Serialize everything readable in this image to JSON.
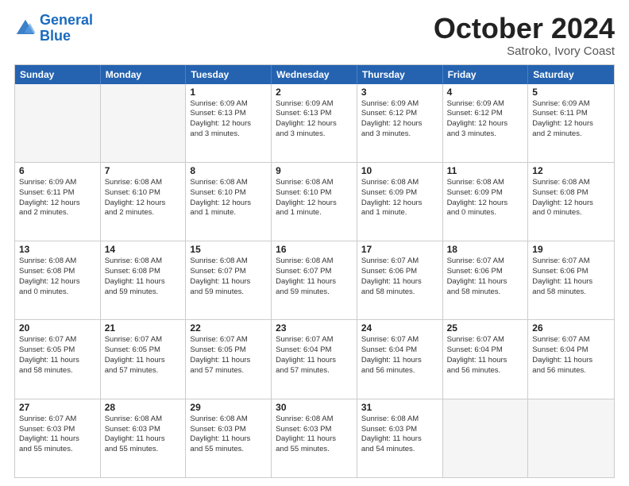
{
  "logo": {
    "line1": "General",
    "line2": "Blue"
  },
  "title": "October 2024",
  "subtitle": "Satroko, Ivory Coast",
  "headers": [
    "Sunday",
    "Monday",
    "Tuesday",
    "Wednesday",
    "Thursday",
    "Friday",
    "Saturday"
  ],
  "weeks": [
    [
      {
        "day": "",
        "lines": []
      },
      {
        "day": "",
        "lines": []
      },
      {
        "day": "1",
        "lines": [
          "Sunrise: 6:09 AM",
          "Sunset: 6:13 PM",
          "Daylight: 12 hours",
          "and 3 minutes."
        ]
      },
      {
        "day": "2",
        "lines": [
          "Sunrise: 6:09 AM",
          "Sunset: 6:13 PM",
          "Daylight: 12 hours",
          "and 3 minutes."
        ]
      },
      {
        "day": "3",
        "lines": [
          "Sunrise: 6:09 AM",
          "Sunset: 6:12 PM",
          "Daylight: 12 hours",
          "and 3 minutes."
        ]
      },
      {
        "day": "4",
        "lines": [
          "Sunrise: 6:09 AM",
          "Sunset: 6:12 PM",
          "Daylight: 12 hours",
          "and 3 minutes."
        ]
      },
      {
        "day": "5",
        "lines": [
          "Sunrise: 6:09 AM",
          "Sunset: 6:11 PM",
          "Daylight: 12 hours",
          "and 2 minutes."
        ]
      }
    ],
    [
      {
        "day": "6",
        "lines": [
          "Sunrise: 6:09 AM",
          "Sunset: 6:11 PM",
          "Daylight: 12 hours",
          "and 2 minutes."
        ]
      },
      {
        "day": "7",
        "lines": [
          "Sunrise: 6:08 AM",
          "Sunset: 6:10 PM",
          "Daylight: 12 hours",
          "and 2 minutes."
        ]
      },
      {
        "day": "8",
        "lines": [
          "Sunrise: 6:08 AM",
          "Sunset: 6:10 PM",
          "Daylight: 12 hours",
          "and 1 minute."
        ]
      },
      {
        "day": "9",
        "lines": [
          "Sunrise: 6:08 AM",
          "Sunset: 6:10 PM",
          "Daylight: 12 hours",
          "and 1 minute."
        ]
      },
      {
        "day": "10",
        "lines": [
          "Sunrise: 6:08 AM",
          "Sunset: 6:09 PM",
          "Daylight: 12 hours",
          "and 1 minute."
        ]
      },
      {
        "day": "11",
        "lines": [
          "Sunrise: 6:08 AM",
          "Sunset: 6:09 PM",
          "Daylight: 12 hours",
          "and 0 minutes."
        ]
      },
      {
        "day": "12",
        "lines": [
          "Sunrise: 6:08 AM",
          "Sunset: 6:08 PM",
          "Daylight: 12 hours",
          "and 0 minutes."
        ]
      }
    ],
    [
      {
        "day": "13",
        "lines": [
          "Sunrise: 6:08 AM",
          "Sunset: 6:08 PM",
          "Daylight: 12 hours",
          "and 0 minutes."
        ]
      },
      {
        "day": "14",
        "lines": [
          "Sunrise: 6:08 AM",
          "Sunset: 6:08 PM",
          "Daylight: 11 hours",
          "and 59 minutes."
        ]
      },
      {
        "day": "15",
        "lines": [
          "Sunrise: 6:08 AM",
          "Sunset: 6:07 PM",
          "Daylight: 11 hours",
          "and 59 minutes."
        ]
      },
      {
        "day": "16",
        "lines": [
          "Sunrise: 6:08 AM",
          "Sunset: 6:07 PM",
          "Daylight: 11 hours",
          "and 59 minutes."
        ]
      },
      {
        "day": "17",
        "lines": [
          "Sunrise: 6:07 AM",
          "Sunset: 6:06 PM",
          "Daylight: 11 hours",
          "and 58 minutes."
        ]
      },
      {
        "day": "18",
        "lines": [
          "Sunrise: 6:07 AM",
          "Sunset: 6:06 PM",
          "Daylight: 11 hours",
          "and 58 minutes."
        ]
      },
      {
        "day": "19",
        "lines": [
          "Sunrise: 6:07 AM",
          "Sunset: 6:06 PM",
          "Daylight: 11 hours",
          "and 58 minutes."
        ]
      }
    ],
    [
      {
        "day": "20",
        "lines": [
          "Sunrise: 6:07 AM",
          "Sunset: 6:05 PM",
          "Daylight: 11 hours",
          "and 58 minutes."
        ]
      },
      {
        "day": "21",
        "lines": [
          "Sunrise: 6:07 AM",
          "Sunset: 6:05 PM",
          "Daylight: 11 hours",
          "and 57 minutes."
        ]
      },
      {
        "day": "22",
        "lines": [
          "Sunrise: 6:07 AM",
          "Sunset: 6:05 PM",
          "Daylight: 11 hours",
          "and 57 minutes."
        ]
      },
      {
        "day": "23",
        "lines": [
          "Sunrise: 6:07 AM",
          "Sunset: 6:04 PM",
          "Daylight: 11 hours",
          "and 57 minutes."
        ]
      },
      {
        "day": "24",
        "lines": [
          "Sunrise: 6:07 AM",
          "Sunset: 6:04 PM",
          "Daylight: 11 hours",
          "and 56 minutes."
        ]
      },
      {
        "day": "25",
        "lines": [
          "Sunrise: 6:07 AM",
          "Sunset: 6:04 PM",
          "Daylight: 11 hours",
          "and 56 minutes."
        ]
      },
      {
        "day": "26",
        "lines": [
          "Sunrise: 6:07 AM",
          "Sunset: 6:04 PM",
          "Daylight: 11 hours",
          "and 56 minutes."
        ]
      }
    ],
    [
      {
        "day": "27",
        "lines": [
          "Sunrise: 6:07 AM",
          "Sunset: 6:03 PM",
          "Daylight: 11 hours",
          "and 55 minutes."
        ]
      },
      {
        "day": "28",
        "lines": [
          "Sunrise: 6:08 AM",
          "Sunset: 6:03 PM",
          "Daylight: 11 hours",
          "and 55 minutes."
        ]
      },
      {
        "day": "29",
        "lines": [
          "Sunrise: 6:08 AM",
          "Sunset: 6:03 PM",
          "Daylight: 11 hours",
          "and 55 minutes."
        ]
      },
      {
        "day": "30",
        "lines": [
          "Sunrise: 6:08 AM",
          "Sunset: 6:03 PM",
          "Daylight: 11 hours",
          "and 55 minutes."
        ]
      },
      {
        "day": "31",
        "lines": [
          "Sunrise: 6:08 AM",
          "Sunset: 6:03 PM",
          "Daylight: 11 hours",
          "and 54 minutes."
        ]
      },
      {
        "day": "",
        "lines": []
      },
      {
        "day": "",
        "lines": []
      }
    ]
  ]
}
